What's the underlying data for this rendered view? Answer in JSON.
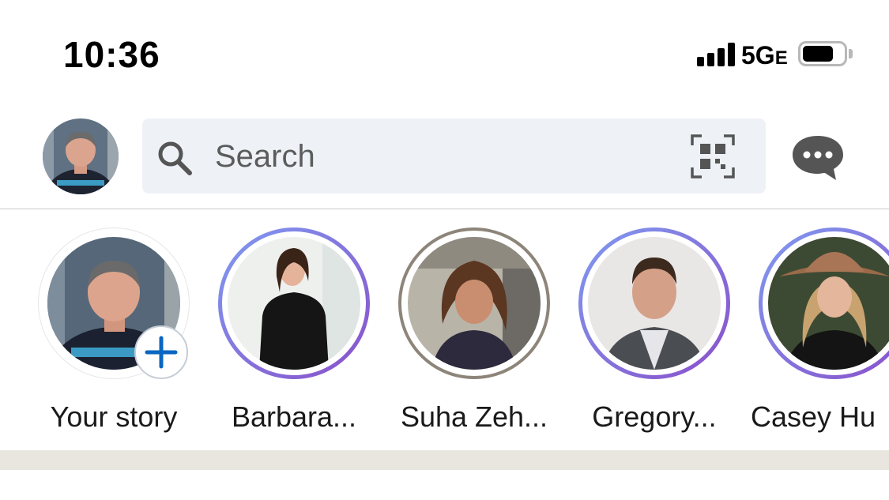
{
  "status_bar": {
    "time": "10:36",
    "network": "5G",
    "network_suffix": "E"
  },
  "header": {
    "search_placeholder": "Search",
    "icons": {
      "search": "search-icon",
      "qr": "qr-code-icon",
      "messages": "messages-icon"
    }
  },
  "stories": [
    {
      "name": "Your story",
      "ring": "none"
    },
    {
      "name": "Barbara...",
      "ring": "gradient"
    },
    {
      "name": "Suha Zeh...",
      "ring": "gray"
    },
    {
      "name": "Gregory...",
      "ring": "gradient"
    },
    {
      "name": "Casey Hu",
      "ring": "gradient"
    }
  ],
  "colors": {
    "accent_blue": "#0a66c2",
    "ring_start": "#7f9bf1",
    "ring_end": "#8a4fc9",
    "ring_gray": "#8e857a",
    "search_bg": "#eef2f7",
    "section_band": "#e9e5df"
  }
}
